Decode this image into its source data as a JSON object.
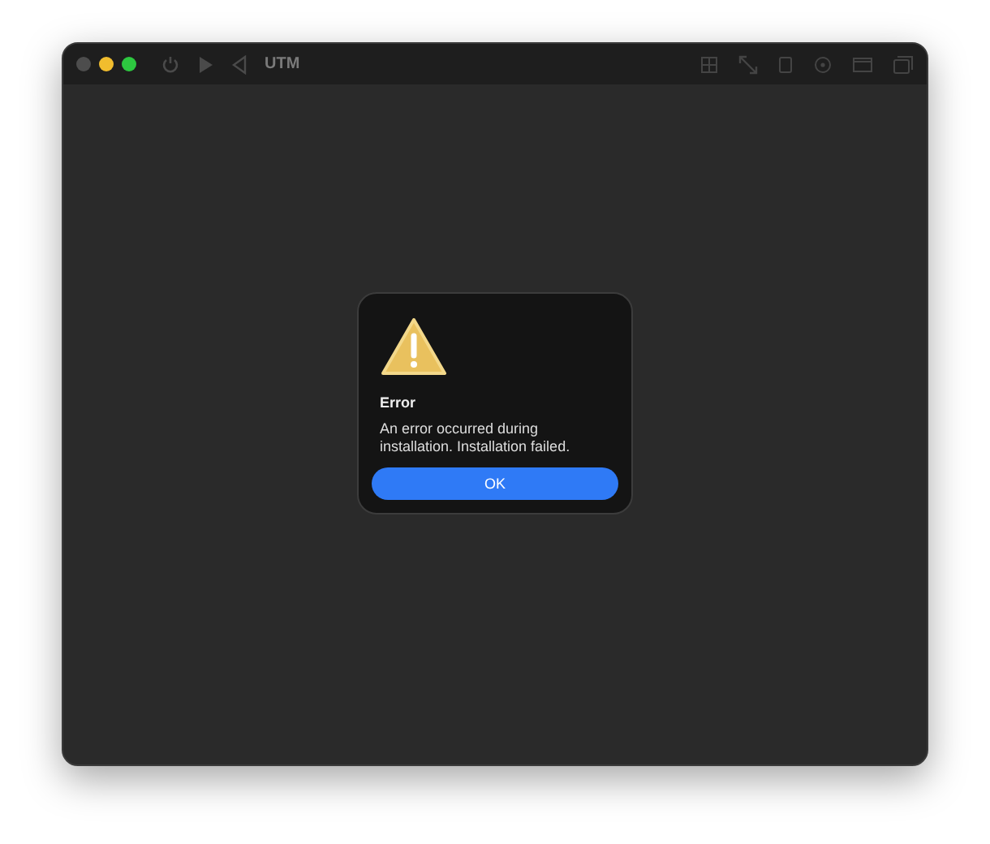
{
  "window": {
    "title": "UTM"
  },
  "dialog": {
    "title": "Error",
    "message": "An error occurred during installation. Installation failed.",
    "buttons": [
      "OK"
    ]
  }
}
